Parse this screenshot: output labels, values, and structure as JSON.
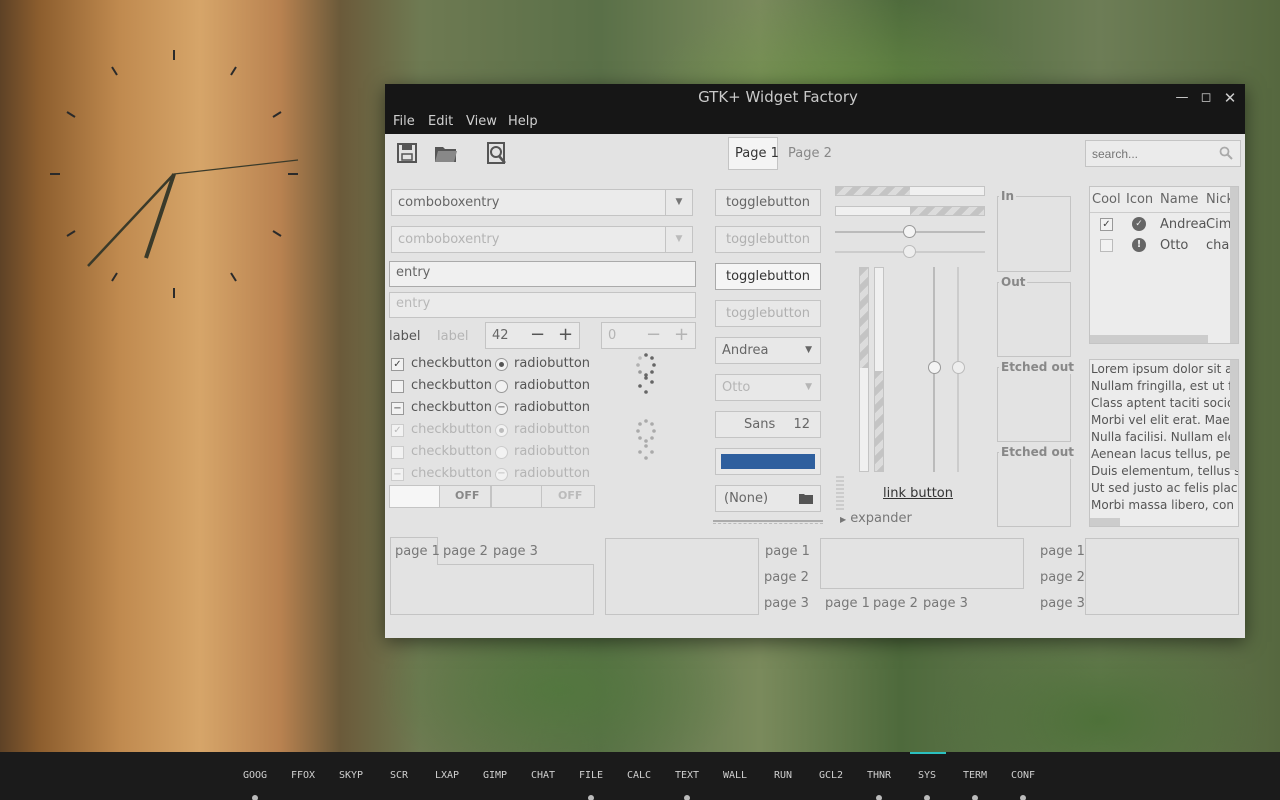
{
  "window": {
    "title": "GTK+ Widget Factory",
    "menus": [
      "File",
      "Edit",
      "View",
      "Help"
    ]
  },
  "toolbar": {
    "tabs": [
      "Page 1",
      "Page 2"
    ],
    "search_placeholder": "search..."
  },
  "left": {
    "combo1": "comboboxentry",
    "combo2": "comboboxentry",
    "entry1": "entry",
    "entry2": "entry",
    "label1": "label",
    "label2": "label",
    "spin1": "42",
    "spin2": "0",
    "check_label": "checkbutton",
    "radio_label": "radiobutton",
    "switch1": "OFF",
    "switch2": "OFF"
  },
  "middle": {
    "toggle": "togglebutton",
    "combo_a": "Andrea",
    "combo_b": "Otto",
    "font": "Sans",
    "font_size": "12",
    "file": "(None)"
  },
  "controls": {
    "link": "link button",
    "expander": "expander"
  },
  "frames": [
    "In",
    "Out",
    "Etched out",
    "Etched out"
  ],
  "tree": {
    "columns": [
      "Cool",
      "Icon",
      "Name",
      "Nick"
    ],
    "rows": [
      {
        "name": "Andrea",
        "nick": "Cimi"
      },
      {
        "name": "Otto",
        "nick": "chao"
      }
    ]
  },
  "text": [
    "Lorem ipsum dolor sit a",
    "Nullam fringilla, est ut fe",
    "Class aptent taciti socio",
    "Morbi vel elit erat. Maec",
    "Nulla facilisi. Nullam ele",
    "Aenean lacus tellus, pell",
    "Duis elementum, tellus s",
    "Ut sed justo ac felis plac",
    "Morbi massa libero, con"
  ],
  "notebook_tabs": [
    "page 1",
    "page 2",
    "page 3"
  ],
  "panel": [
    "GOOG",
    "FFOX",
    "SKYP",
    "SCR",
    "LXAP",
    "GIMP",
    "CHAT",
    "FILE",
    "CALC",
    "TEXT",
    "WALL",
    "RUN",
    "GCL2",
    "THNR",
    "SYS",
    "TERM",
    "CONF"
  ],
  "colors": {
    "accent": "#2e5f9e",
    "panel_active": "#2bc0c0"
  }
}
